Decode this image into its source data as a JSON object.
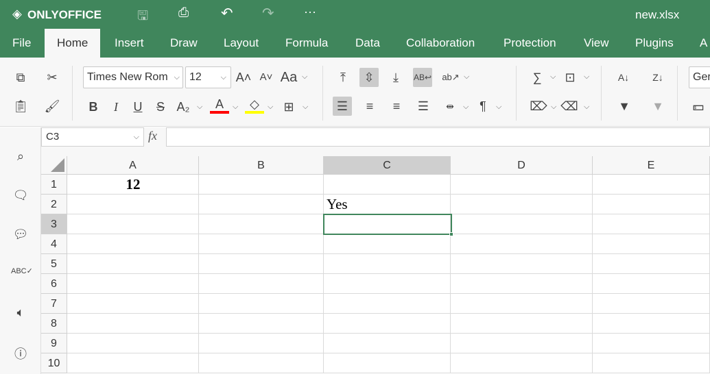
{
  "app": {
    "logo": "ONLYOFFICE",
    "file_name": "new.xlsx"
  },
  "menu_tabs": [
    "File",
    "Home",
    "Insert",
    "Draw",
    "Layout",
    "Formula",
    "Data",
    "Collaboration",
    "Protection",
    "View",
    "Plugins",
    "A"
  ],
  "active_tab": "Home",
  "toolbar": {
    "font_name": "Times New Rom",
    "font_size": "12",
    "number_format": "Ger",
    "font_color": "#ff0000",
    "highlight_color": "#ffff00"
  },
  "formula_bar": {
    "name_box": "C3",
    "fx_label": "fx",
    "value": ""
  },
  "sheet": {
    "columns": [
      "A",
      "B",
      "C",
      "D",
      "E"
    ],
    "rows": [
      "1",
      "2",
      "3",
      "4",
      "5",
      "6",
      "7",
      "8",
      "9",
      "10"
    ],
    "selected_cell": "C3",
    "cells": {
      "A1": "12",
      "C2": "Yes"
    }
  },
  "colors": {
    "brand": "#40865c",
    "selection": "#40865c"
  }
}
